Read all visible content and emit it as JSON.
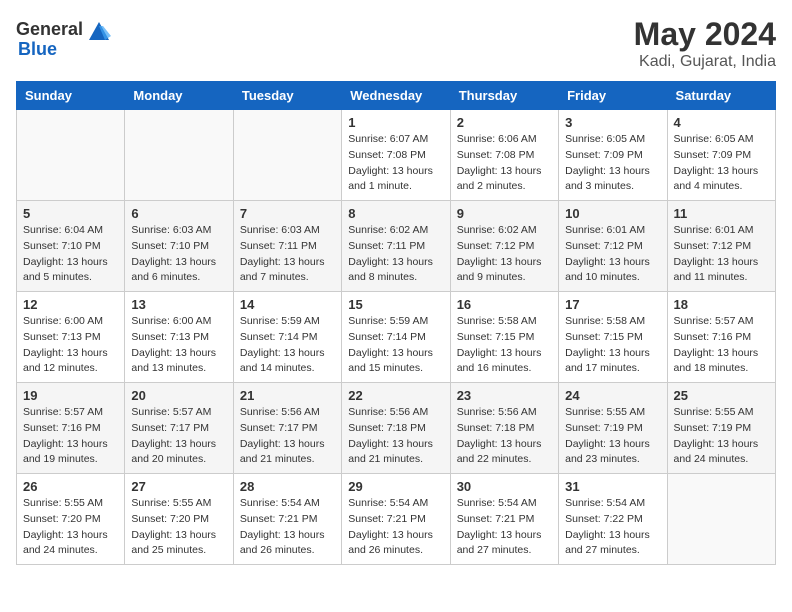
{
  "header": {
    "logo_general": "General",
    "logo_blue": "Blue",
    "title": "May 2024",
    "subtitle": "Kadi, Gujarat, India"
  },
  "weekdays": [
    "Sunday",
    "Monday",
    "Tuesday",
    "Wednesday",
    "Thursday",
    "Friday",
    "Saturday"
  ],
  "weeks": [
    [
      {
        "day": "",
        "info": ""
      },
      {
        "day": "",
        "info": ""
      },
      {
        "day": "",
        "info": ""
      },
      {
        "day": "1",
        "info": "Sunrise: 6:07 AM\nSunset: 7:08 PM\nDaylight: 13 hours\nand 1 minute."
      },
      {
        "day": "2",
        "info": "Sunrise: 6:06 AM\nSunset: 7:08 PM\nDaylight: 13 hours\nand 2 minutes."
      },
      {
        "day": "3",
        "info": "Sunrise: 6:05 AM\nSunset: 7:09 PM\nDaylight: 13 hours\nand 3 minutes."
      },
      {
        "day": "4",
        "info": "Sunrise: 6:05 AM\nSunset: 7:09 PM\nDaylight: 13 hours\nand 4 minutes."
      }
    ],
    [
      {
        "day": "5",
        "info": "Sunrise: 6:04 AM\nSunset: 7:10 PM\nDaylight: 13 hours\nand 5 minutes."
      },
      {
        "day": "6",
        "info": "Sunrise: 6:03 AM\nSunset: 7:10 PM\nDaylight: 13 hours\nand 6 minutes."
      },
      {
        "day": "7",
        "info": "Sunrise: 6:03 AM\nSunset: 7:11 PM\nDaylight: 13 hours\nand 7 minutes."
      },
      {
        "day": "8",
        "info": "Sunrise: 6:02 AM\nSunset: 7:11 PM\nDaylight: 13 hours\nand 8 minutes."
      },
      {
        "day": "9",
        "info": "Sunrise: 6:02 AM\nSunset: 7:12 PM\nDaylight: 13 hours\nand 9 minutes."
      },
      {
        "day": "10",
        "info": "Sunrise: 6:01 AM\nSunset: 7:12 PM\nDaylight: 13 hours\nand 10 minutes."
      },
      {
        "day": "11",
        "info": "Sunrise: 6:01 AM\nSunset: 7:12 PM\nDaylight: 13 hours\nand 11 minutes."
      }
    ],
    [
      {
        "day": "12",
        "info": "Sunrise: 6:00 AM\nSunset: 7:13 PM\nDaylight: 13 hours\nand 12 minutes."
      },
      {
        "day": "13",
        "info": "Sunrise: 6:00 AM\nSunset: 7:13 PM\nDaylight: 13 hours\nand 13 minutes."
      },
      {
        "day": "14",
        "info": "Sunrise: 5:59 AM\nSunset: 7:14 PM\nDaylight: 13 hours\nand 14 minutes."
      },
      {
        "day": "15",
        "info": "Sunrise: 5:59 AM\nSunset: 7:14 PM\nDaylight: 13 hours\nand 15 minutes."
      },
      {
        "day": "16",
        "info": "Sunrise: 5:58 AM\nSunset: 7:15 PM\nDaylight: 13 hours\nand 16 minutes."
      },
      {
        "day": "17",
        "info": "Sunrise: 5:58 AM\nSunset: 7:15 PM\nDaylight: 13 hours\nand 17 minutes."
      },
      {
        "day": "18",
        "info": "Sunrise: 5:57 AM\nSunset: 7:16 PM\nDaylight: 13 hours\nand 18 minutes."
      }
    ],
    [
      {
        "day": "19",
        "info": "Sunrise: 5:57 AM\nSunset: 7:16 PM\nDaylight: 13 hours\nand 19 minutes."
      },
      {
        "day": "20",
        "info": "Sunrise: 5:57 AM\nSunset: 7:17 PM\nDaylight: 13 hours\nand 20 minutes."
      },
      {
        "day": "21",
        "info": "Sunrise: 5:56 AM\nSunset: 7:17 PM\nDaylight: 13 hours\nand 21 minutes."
      },
      {
        "day": "22",
        "info": "Sunrise: 5:56 AM\nSunset: 7:18 PM\nDaylight: 13 hours\nand 21 minutes."
      },
      {
        "day": "23",
        "info": "Sunrise: 5:56 AM\nSunset: 7:18 PM\nDaylight: 13 hours\nand 22 minutes."
      },
      {
        "day": "24",
        "info": "Sunrise: 5:55 AM\nSunset: 7:19 PM\nDaylight: 13 hours\nand 23 minutes."
      },
      {
        "day": "25",
        "info": "Sunrise: 5:55 AM\nSunset: 7:19 PM\nDaylight: 13 hours\nand 24 minutes."
      }
    ],
    [
      {
        "day": "26",
        "info": "Sunrise: 5:55 AM\nSunset: 7:20 PM\nDaylight: 13 hours\nand 24 minutes."
      },
      {
        "day": "27",
        "info": "Sunrise: 5:55 AM\nSunset: 7:20 PM\nDaylight: 13 hours\nand 25 minutes."
      },
      {
        "day": "28",
        "info": "Sunrise: 5:54 AM\nSunset: 7:21 PM\nDaylight: 13 hours\nand 26 minutes."
      },
      {
        "day": "29",
        "info": "Sunrise: 5:54 AM\nSunset: 7:21 PM\nDaylight: 13 hours\nand 26 minutes."
      },
      {
        "day": "30",
        "info": "Sunrise: 5:54 AM\nSunset: 7:21 PM\nDaylight: 13 hours\nand 27 minutes."
      },
      {
        "day": "31",
        "info": "Sunrise: 5:54 AM\nSunset: 7:22 PM\nDaylight: 13 hours\nand 27 minutes."
      },
      {
        "day": "",
        "info": ""
      }
    ]
  ]
}
